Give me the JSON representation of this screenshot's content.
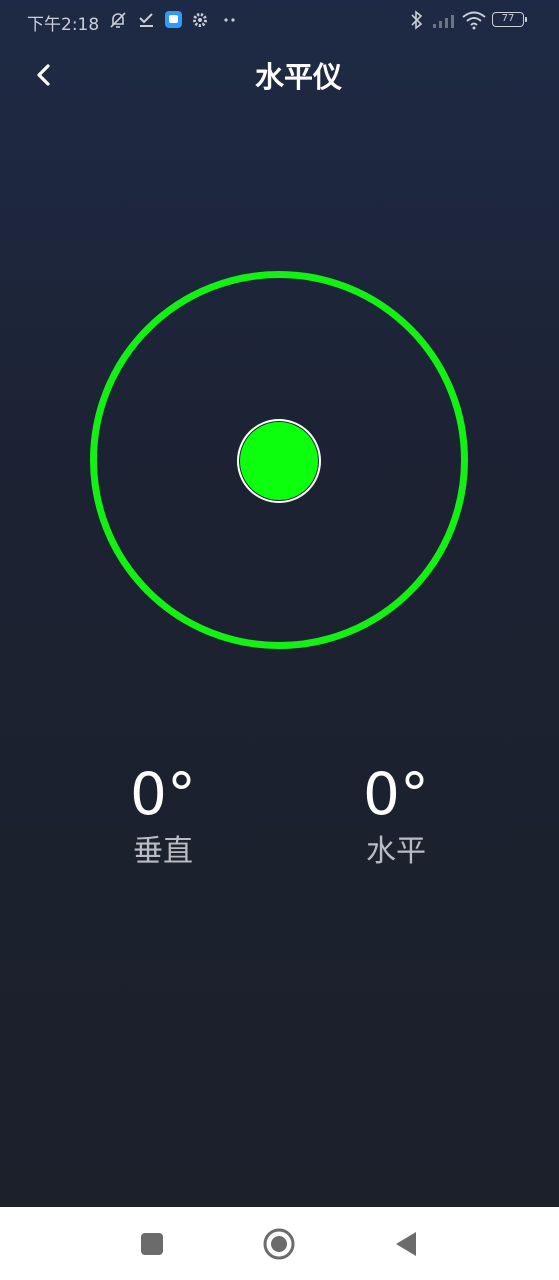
{
  "status_bar": {
    "time": "下午2:18",
    "battery": "77",
    "icons": [
      "mute-icon",
      "check-icon",
      "app-notification-icon",
      "settings-icon",
      "more-dots-icon",
      "bluetooth-icon",
      "signal-icon",
      "wifi-icon",
      "battery-icon"
    ]
  },
  "header": {
    "back_icon": "chevron-left-icon",
    "title": "水平仪"
  },
  "level": {
    "ring_color": "#14f014",
    "bubble_color": "#0cff0c"
  },
  "readouts": {
    "vertical": {
      "value": "0°",
      "label": "垂直"
    },
    "horizontal": {
      "value": "0°",
      "label": "水平"
    }
  },
  "nav_bar": {
    "buttons": [
      "recents-square-icon",
      "home-circle-icon",
      "back-triangle-icon"
    ]
  }
}
